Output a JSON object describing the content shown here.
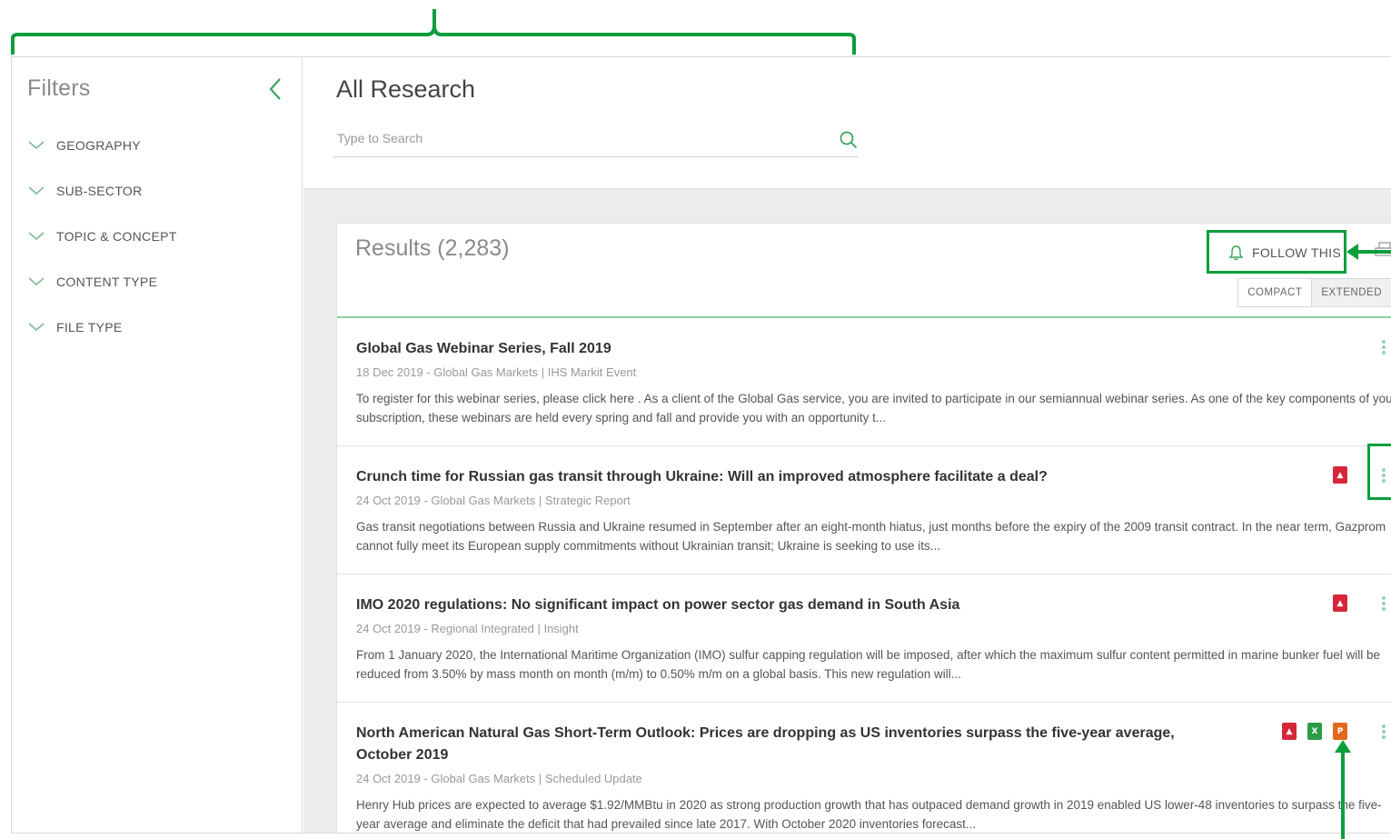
{
  "sidebar": {
    "title": "Filters",
    "items": [
      {
        "label": "GEOGRAPHY"
      },
      {
        "label": "SUB-SECTOR"
      },
      {
        "label": "TOPIC & CONCEPT"
      },
      {
        "label": "CONTENT TYPE"
      },
      {
        "label": "FILE TYPE"
      }
    ]
  },
  "header": {
    "title": "All Research",
    "search": {
      "placeholder": "Type to Search",
      "value": ""
    }
  },
  "results": {
    "title": "Results (2,283)",
    "follow_label": "FOLLOW THIS",
    "view_modes": {
      "compact": "COMPACT",
      "extended": "EXTENDED",
      "selected": "EXTENDED"
    },
    "items": [
      {
        "title": "Global Gas Webinar Series, Fall 2019",
        "meta": "18 Dec 2019 - Global Gas Markets | IHS Markit Event",
        "desc": "To register for this webinar series, please click here . As a client of the Global Gas service, you are invited to participate in our semiannual webinar series. As one of the key components of your subscription, these webinars are held every spring and fall and provide you with an opportunity t...",
        "files": []
      },
      {
        "title": "Crunch time for Russian gas transit through Ukraine: Will an improved atmosphere facilitate a deal?",
        "meta": "24 Oct 2019 - Global Gas Markets | Strategic Report",
        "desc": "Gas transit negotiations between Russia and Ukraine resumed in September after an eight-month hiatus, just months before the expiry of the 2009 transit contract. In the near term, Gazprom cannot fully meet its European supply commitments without Ukrainian transit; Ukraine is seeking to use its...",
        "files": [
          "pdf"
        ]
      },
      {
        "title": "IMO 2020 regulations: No significant impact on power sector gas demand in South Asia",
        "meta": "24 Oct 2019 - Regional Integrated | Insight",
        "desc": "From 1 January 2020, the International Maritime Organization (IMO) sulfur capping regulation will be imposed, after which the maximum sulfur content permitted in marine bunker fuel will be reduced from 3.50% by mass month on month (m/m) to 0.50% m/m on a global basis. This new regulation will...",
        "files": [
          "pdf"
        ]
      },
      {
        "title": "North American Natural Gas Short-Term Outlook: Prices are dropping as US inventories surpass the five-year average, October 2019",
        "meta": "24 Oct 2019 - Global Gas Markets | Scheduled Update",
        "desc": "Henry Hub prices are expected to average $1.92/MMBtu in 2020 as strong production growth that has outpaced demand growth in 2019 enabled US lower-48 inventories to surpass the five-year average and eliminate the deficit that had prevailed since late 2017. With October 2020 inventories forecast...",
        "files": [
          "pdf",
          "xls",
          "ppt"
        ]
      }
    ]
  },
  "colors": {
    "accent": "#0b9e3b",
    "pdf": "#d6263a",
    "xls": "#2e9a4a",
    "ppt": "#e06a1b"
  }
}
